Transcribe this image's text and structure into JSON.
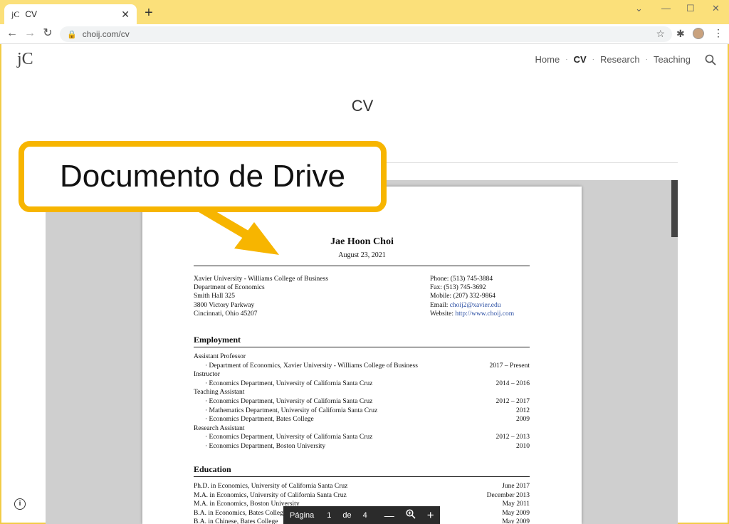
{
  "browser": {
    "tab_favicon": "jC",
    "tab_title": "CV",
    "tab_close": "✕",
    "new_tab": "+",
    "url": "choij.com/cv"
  },
  "site": {
    "logo": "jC",
    "nav": [
      "Home",
      "CV",
      "Research",
      "Teaching"
    ],
    "nav_active": "CV",
    "page_title": "CV"
  },
  "callout": {
    "text": "Documento de Drive",
    "color": "#f7b500"
  },
  "document": {
    "name": "Jae Hoon Choi",
    "date": "August 23, 2021",
    "contact_left": [
      "Xavier University - Williams College of Business",
      "Department of Economics",
      "Smith Hall 325",
      "3800 Victory Parkway",
      "Cincinnati, Ohio 45207"
    ],
    "contact_right": [
      {
        "label": "Phone:",
        "value": "(513) 745-3884"
      },
      {
        "label": "Fax:",
        "value": "(513) 745-3692"
      },
      {
        "label": "Mobile:",
        "value": "(207) 332-9864"
      },
      {
        "label": "Email:",
        "value": "choij2@xavier.edu"
      },
      {
        "label": "Website:",
        "value": "http://www.choij.com"
      }
    ],
    "employment_heading": "Employment",
    "employment": [
      {
        "text": "Assistant Professor",
        "date": "",
        "sub": false
      },
      {
        "text": "· Department of Economics, Xavier University - Williams College of Business",
        "date": "2017 – Present",
        "sub": true
      },
      {
        "text": "Instructor",
        "date": "",
        "sub": false
      },
      {
        "text": "· Economics Department, University of California Santa Cruz",
        "date": "2014 – 2016",
        "sub": true
      },
      {
        "text": "Teaching Assistant",
        "date": "",
        "sub": false
      },
      {
        "text": "· Economics Department, University of California Santa Cruz",
        "date": "2012 – 2017",
        "sub": true
      },
      {
        "text": "· Mathematics Department, University of California Santa Cruz",
        "date": "2012",
        "sub": true
      },
      {
        "text": "· Economics Department, Bates College",
        "date": "2009",
        "sub": true
      },
      {
        "text": "Research Assistant",
        "date": "",
        "sub": false
      },
      {
        "text": "· Economics Department, University of California Santa Cruz",
        "date": "2012 – 2013",
        "sub": true
      },
      {
        "text": "· Economics Department, Boston University",
        "date": "2010",
        "sub": true
      }
    ],
    "education_heading": "Education",
    "education": [
      {
        "text": "Ph.D. in Economics, University of California Santa Cruz",
        "date": "June 2017"
      },
      {
        "text": "M.A. in Economics, University of California Santa Cruz",
        "date": "December 2013"
      },
      {
        "text": "M.A. in Economics, Boston University",
        "date": "May 2011"
      },
      {
        "text": "B.A. in Economics, Bates College",
        "date": "May 2009"
      },
      {
        "text": "B.A. in Chinese, Bates College",
        "date": "May 2009"
      }
    ]
  },
  "pager": {
    "label": "Página",
    "current": "1",
    "of": "de",
    "total": "4",
    "zoom_out": "—",
    "zoom_in": "+"
  }
}
